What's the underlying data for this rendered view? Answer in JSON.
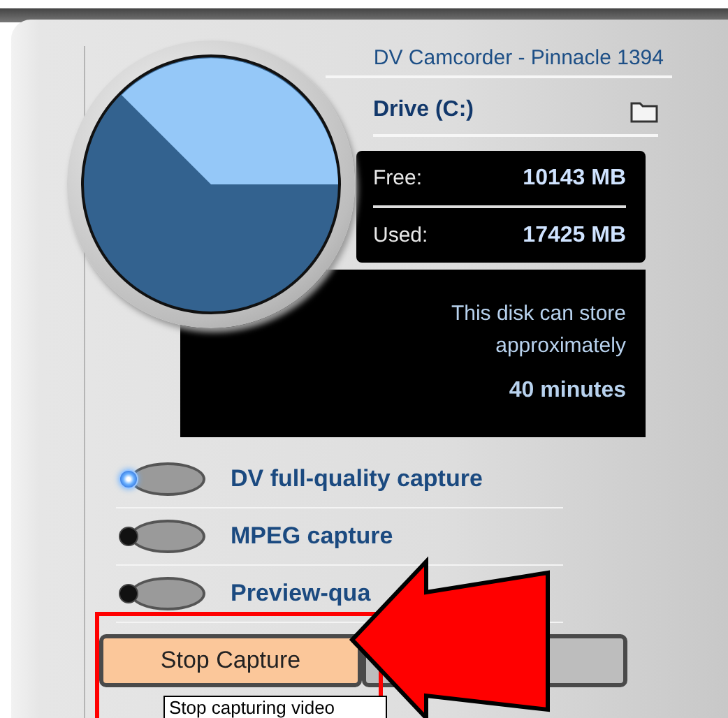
{
  "window": {
    "device": "DV Camcorder - Pinnacle 1394"
  },
  "drive": {
    "name": "Drive (C:)"
  },
  "stats": [
    {
      "label": "Free:",
      "value": "10143 MB"
    },
    {
      "label": "Used:",
      "value": "17425 MB"
    }
  ],
  "capacity": {
    "note": "This disk can store approximately",
    "duration": "40 minutes"
  },
  "options": [
    {
      "label": "DV full-quality capture",
      "selected": true
    },
    {
      "label": "MPEG capture",
      "selected": false
    },
    {
      "label": "Preview-qua",
      "selected": false
    }
  ],
  "buttons": [
    {
      "label": "Stop Capture",
      "kind": "primary"
    }
  ],
  "tooltip": {
    "text": "Stop capturing video"
  }
}
